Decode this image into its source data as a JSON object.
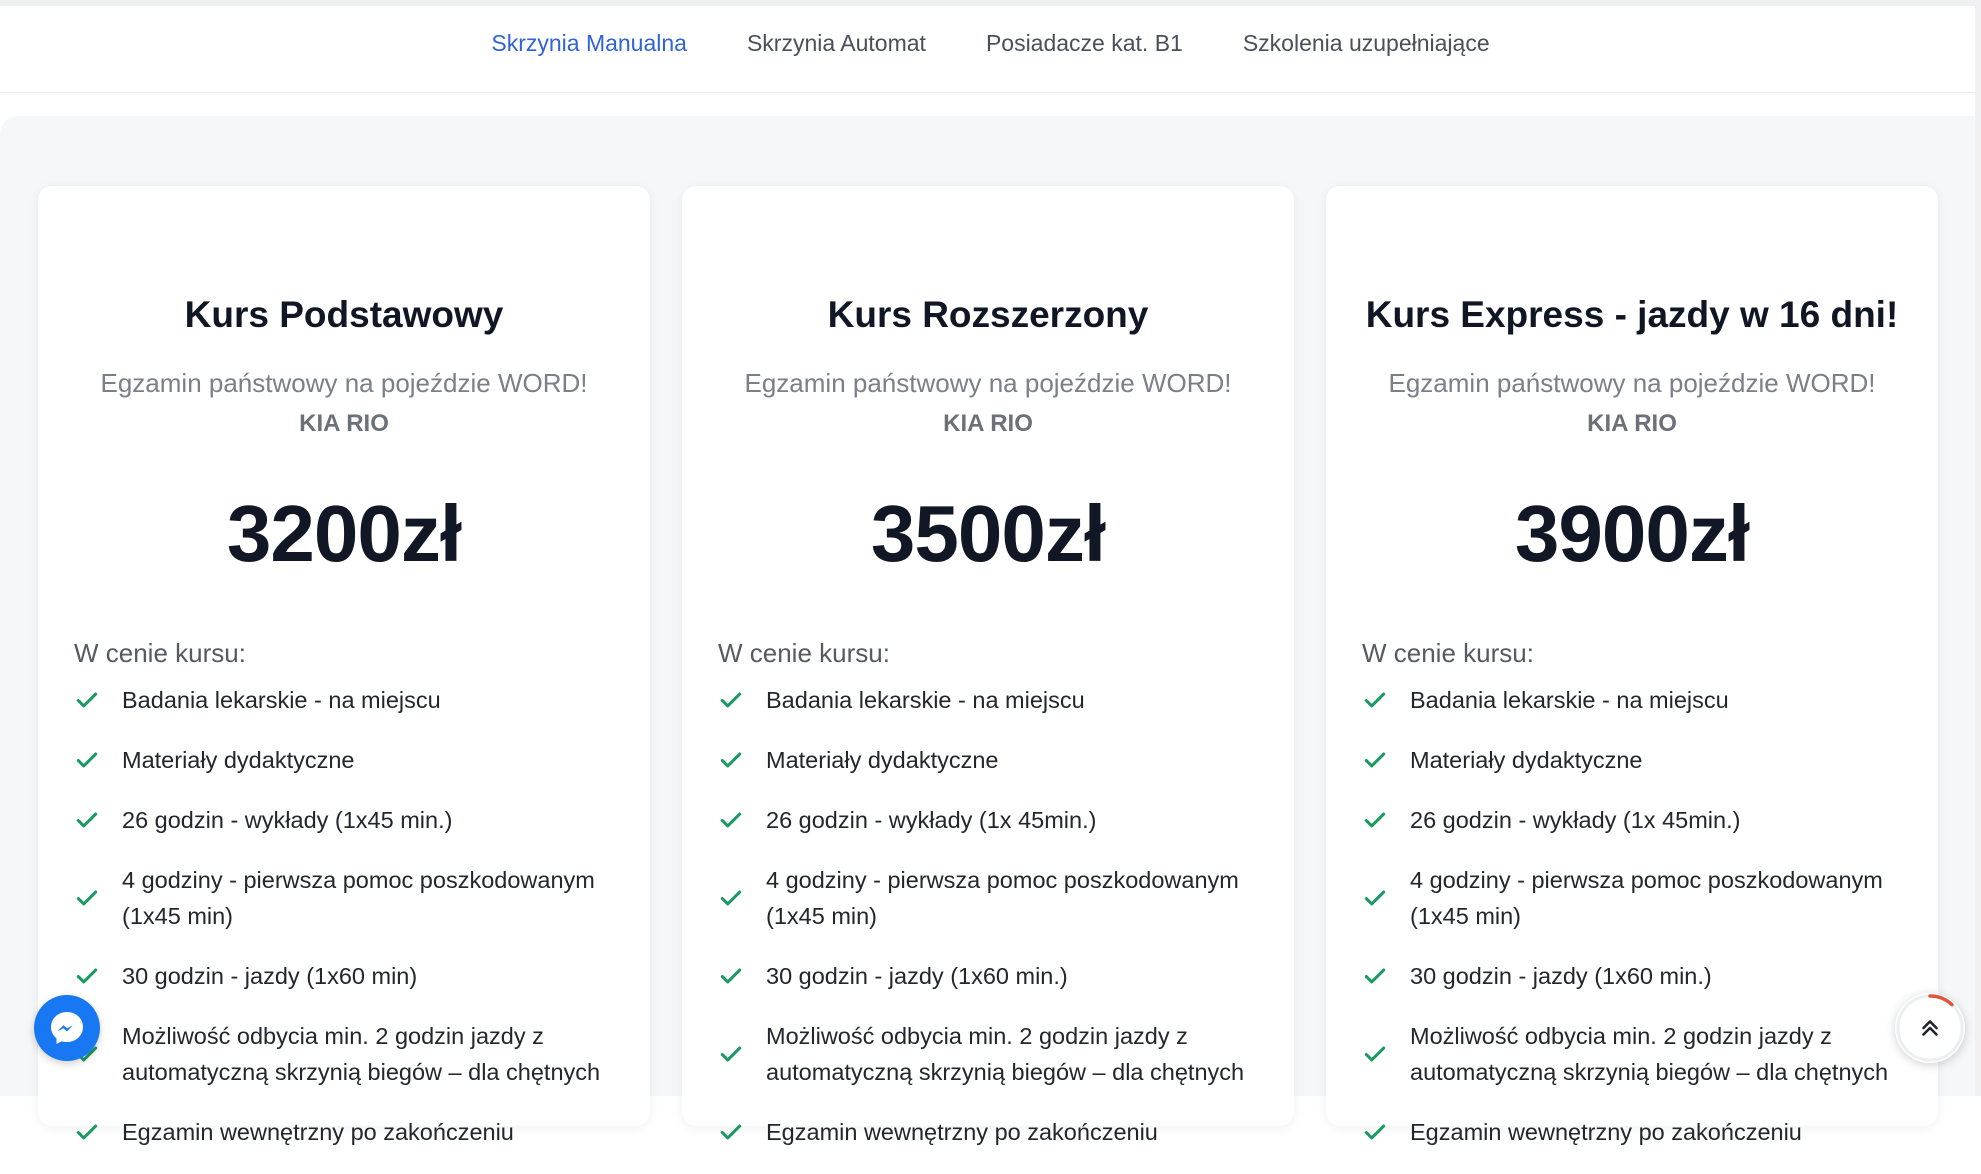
{
  "nav": {
    "tabs": [
      {
        "label": "Skrzynia Manualna",
        "active": true
      },
      {
        "label": "Skrzynia Automat",
        "active": false
      },
      {
        "label": "Posiadacze kat. B1",
        "active": false
      },
      {
        "label": "Szkolenia uzupełniające",
        "active": false
      }
    ]
  },
  "colors": {
    "active_tab": "#2f63d6",
    "check": "#1a9a63",
    "messenger": "#1877f2",
    "scroll_progress": "#e2553d"
  },
  "cards": [
    {
      "title": "Kurs Podstawowy",
      "subtitle": "Egzamin państwowy na pojeździe WORD!",
      "car": "KIA RIO",
      "price": "3200zł",
      "includes_label": "W cenie kursu:",
      "features": [
        "Badania lekarskie - na miejscu",
        "Materiały dydaktyczne",
        "26 godzin - wykłady (1x45 min.)",
        "4 godziny - pierwsza pomoc poszkodowanym (1x45 min)",
        "30 godzin - jazdy (1x60 min)",
        "Możliwość odbycia min. 2 godzin jazdy z automatyczną skrzynią biegów – dla chętnych",
        "Egzamin wewnętrzny po zakończeniu"
      ]
    },
    {
      "title": "Kurs Rozszerzony",
      "subtitle": "Egzamin państwowy na pojeździe WORD!",
      "car": "KIA RIO",
      "price": "3500zł",
      "includes_label": "W cenie kursu:",
      "features": [
        "Badania lekarskie - na miejscu",
        "Materiały dydaktyczne",
        "26 godzin - wykłady (1x 45min.)",
        "4 godziny - pierwsza pomoc poszkodowanym (1x45 min)",
        "30 godzin - jazdy (1x60 min.)",
        "Możliwość odbycia min. 2 godzin jazdy z automatyczną skrzynią biegów – dla chętnych",
        "Egzamin wewnętrzny po zakończeniu"
      ]
    },
    {
      "title": "Kurs Express - jazdy w 16 dni!",
      "subtitle": "Egzamin państwowy na pojeździe WORD!",
      "car": "KIA RIO",
      "price": "3900zł",
      "includes_label": "W cenie kursu:",
      "features": [
        "Badania lekarskie - na miejscu",
        "Materiały dydaktyczne",
        "26 godzin - wykłady (1x 45min.)",
        "4 godziny - pierwsza pomoc poszkodowanym (1x45 min)",
        "30 godzin - jazdy (1x60 min.)",
        "Możliwość odbycia min. 2 godzin jazdy z automatyczną skrzynią biegów – dla chętnych",
        "Egzamin wewnętrzny po zakończeniu"
      ]
    }
  ],
  "widgets": {
    "messenger_icon": "messenger-icon",
    "scroll_top_icon": "double-chevron-up-icon",
    "scroll_progress_fraction": 0.12
  }
}
